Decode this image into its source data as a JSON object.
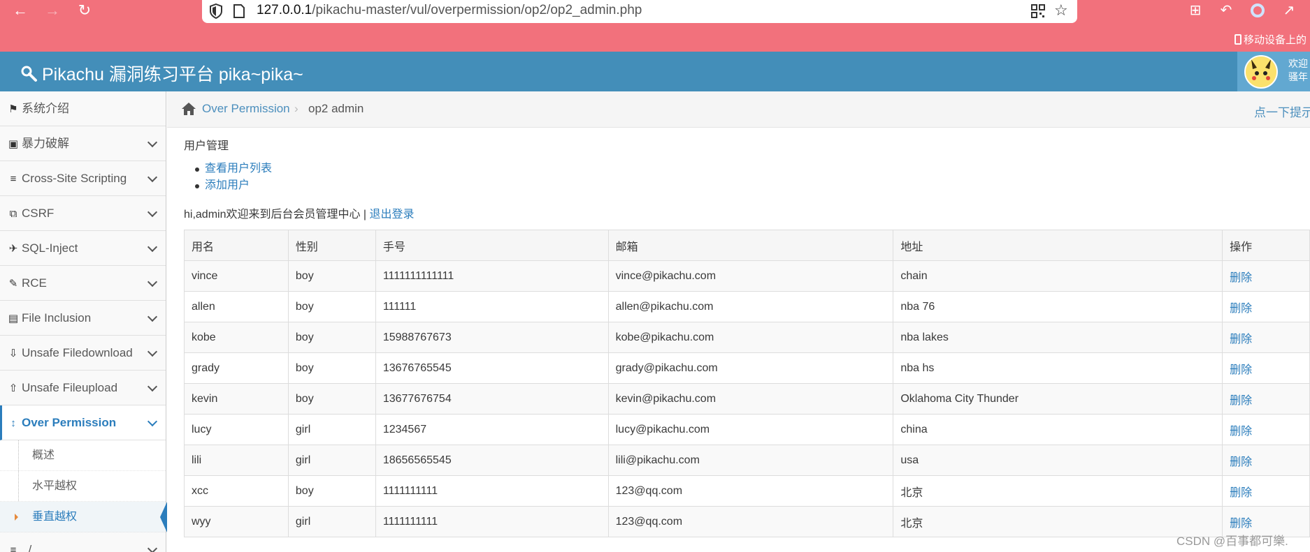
{
  "browser": {
    "url_host": "127.0.0.1",
    "url_path": "/pikachu-master/vul/overpermission/op2/op2_admin.php",
    "mobile_bookmarks": "移动设备上的"
  },
  "header": {
    "brand": "Pikachu 漏洞练习平台 pika~pika~",
    "user_line1": "欢迎",
    "user_line2": "骚年"
  },
  "sidebar": {
    "items": [
      {
        "label": "系统介绍",
        "icon": "tag-icon"
      },
      {
        "label": "暴力破解",
        "icon": "lock-icon"
      },
      {
        "label": "Cross-Site Scripting",
        "icon": "list-tree-icon"
      },
      {
        "label": "CSRF",
        "icon": "share-icon"
      },
      {
        "label": "SQL-Inject",
        "icon": "plane-icon"
      },
      {
        "label": "RCE",
        "icon": "pencil-icon"
      },
      {
        "label": "File Inclusion",
        "icon": "file-icon"
      },
      {
        "label": "Unsafe Filedownload",
        "icon": "download-icon"
      },
      {
        "label": "Unsafe Fileupload",
        "icon": "upload-icon"
      },
      {
        "label": "Over Permission",
        "icon": "text-height-icon"
      }
    ],
    "sub_items": [
      "概述",
      "水平越权",
      "垂直越权"
    ],
    "next_item": "../.."
  },
  "breadcrumb": {
    "section": "Over Permission",
    "current": "op2 admin",
    "tip": "点一下提示"
  },
  "content": {
    "section_title": "用户管理",
    "links": [
      "查看用户列表",
      "添加用户"
    ],
    "welcome": "hi,admin欢迎来到后台会员管理中心 | ",
    "logout": "退出登录"
  },
  "table": {
    "headers": [
      "用名",
      "性别",
      "手号",
      "邮箱",
      "地址",
      "操作"
    ],
    "rows": [
      [
        "vince",
        "boy",
        "1111111111111",
        "vince@pikachu.com",
        "chain",
        "删除"
      ],
      [
        "allen",
        "boy",
        "111111",
        "allen@pikachu.com",
        "nba 76",
        "删除"
      ],
      [
        "kobe",
        "boy",
        "15988767673",
        "kobe@pikachu.com",
        "nba lakes",
        "删除"
      ],
      [
        "grady",
        "boy",
        "13676765545",
        "grady@pikachu.com",
        "nba hs",
        "删除"
      ],
      [
        "kevin",
        "boy",
        "13677676754",
        "kevin@pikachu.com",
        "Oklahoma City Thunder",
        "删除"
      ],
      [
        "lucy",
        "girl",
        "1234567",
        "lucy@pikachu.com",
        "china",
        "删除"
      ],
      [
        "lili",
        "girl",
        "18656565545",
        "lili@pikachu.com",
        "usa",
        "删除"
      ],
      [
        "xcc",
        "boy",
        "1111111111",
        "123@qq.com",
        "北京",
        "删除"
      ],
      [
        "wyy",
        "girl",
        "1111111111",
        "123@qq.com",
        "北京",
        "删除"
      ]
    ]
  },
  "watermark": "CSDN @百事都可樂.",
  "colors": {
    "browser_bar": "#f2717c",
    "header": "#438eb9",
    "link": "#2b7dbc"
  }
}
